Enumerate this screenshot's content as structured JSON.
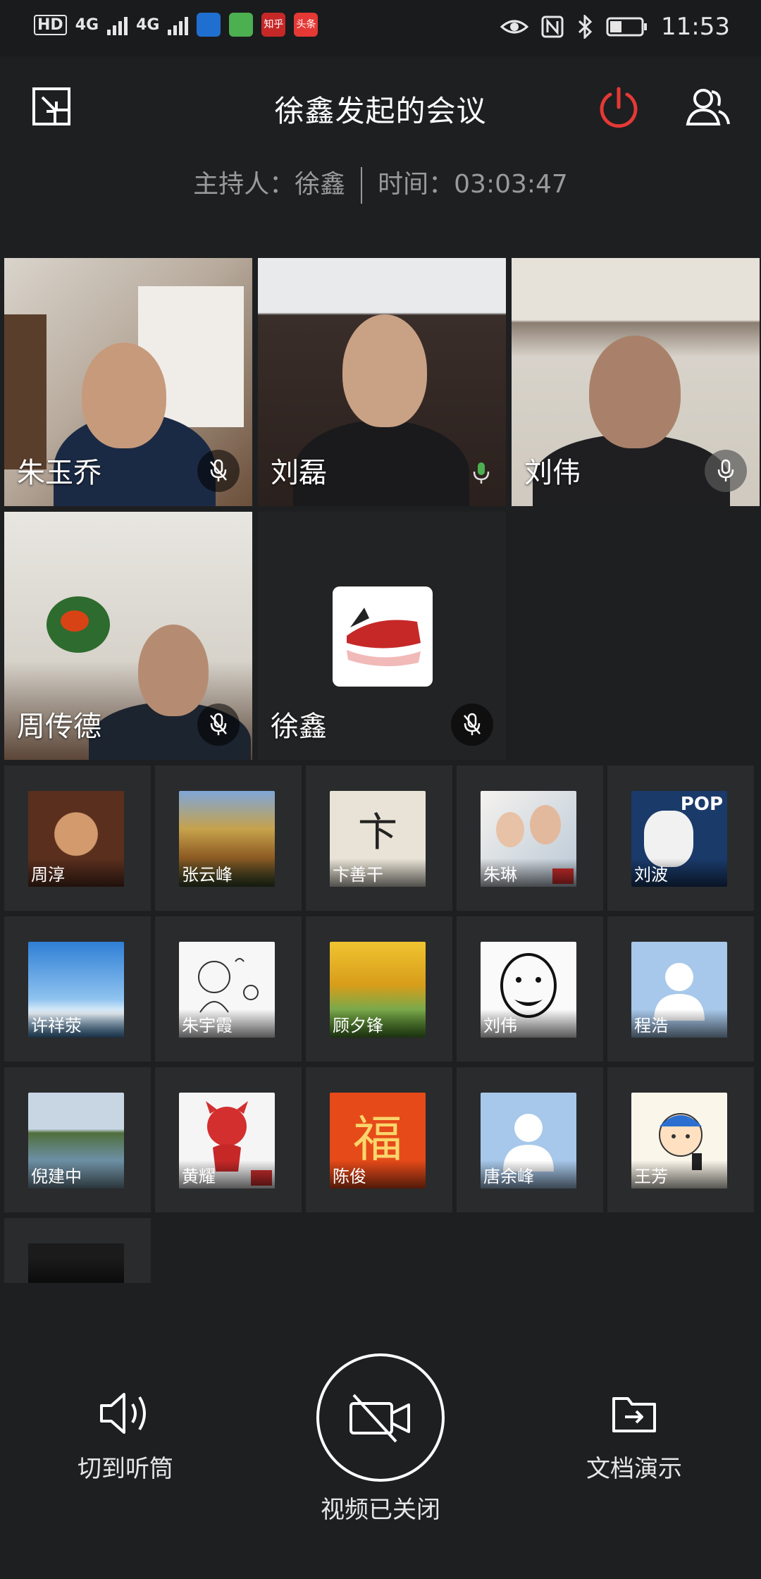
{
  "status_bar": {
    "network_hd": "HD",
    "network_4g_1": "4G",
    "network_4g_2": "4G",
    "app_badge_1": "知乎",
    "app_badge_2": "头条",
    "time": "11:53"
  },
  "header": {
    "title": "徐鑫发起的会议",
    "host_label": "主持人：徐鑫",
    "time_label": "时间：03:03:47"
  },
  "video_tiles": [
    {
      "name": "朱玉乔",
      "mic": "muted"
    },
    {
      "name": "刘磊",
      "mic": "active"
    },
    {
      "name": "刘伟",
      "mic": "muted"
    },
    {
      "name": "周传德",
      "mic": "muted"
    },
    {
      "name": "徐鑫",
      "mic": "muted"
    }
  ],
  "participants": [
    {
      "name": "周淳"
    },
    {
      "name": "张云峰"
    },
    {
      "name": "卞善干"
    },
    {
      "name": "朱琳"
    },
    {
      "name": "刘波"
    },
    {
      "name": "许祥荥"
    },
    {
      "name": "朱宇霞"
    },
    {
      "name": "顾夕锋"
    },
    {
      "name": "刘伟"
    },
    {
      "name": "程浩"
    },
    {
      "name": "倪建中"
    },
    {
      "name": "黄耀"
    },
    {
      "name": "陈俊"
    },
    {
      "name": "唐余峰"
    },
    {
      "name": "王芳"
    },
    {
      "name": ""
    }
  ],
  "avatar_art": {
    "pop_text": "POP",
    "calligraphy": "卞",
    "fu": "福"
  },
  "controls": {
    "speaker_label": "切到听筒",
    "video_label": "视频已关闭",
    "docs_label": "文档演示"
  },
  "colors": {
    "background": "#1e1f21",
    "power_red": "#e53935",
    "mic_green": "#4caf50",
    "text_muted": "#9a9a9a"
  }
}
